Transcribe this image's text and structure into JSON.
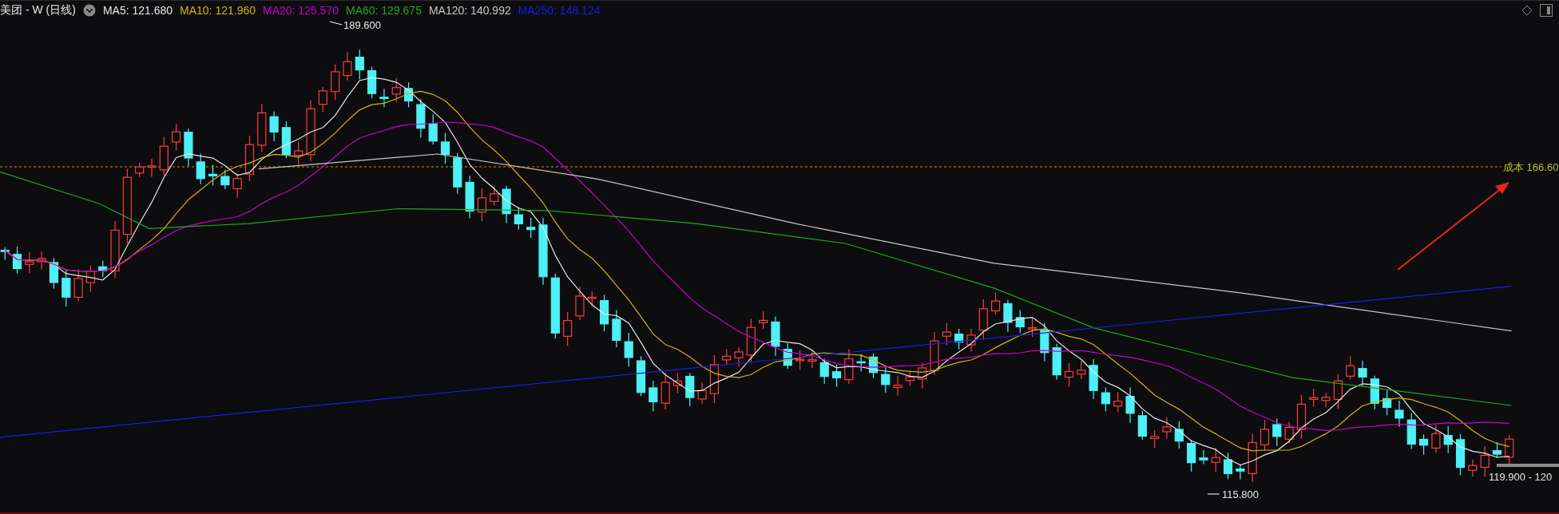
{
  "header": {
    "title": "美团 - W (日线)",
    "indicators": [
      {
        "label": "MA5: 121.680",
        "color": "#e6e6e6"
      },
      {
        "label": "MA10: 121.960",
        "color": "#d6b400"
      },
      {
        "label": "MA20: 125.570",
        "color": "#c800c8"
      },
      {
        "label": "MA60: 129.675",
        "color": "#1fa81f"
      },
      {
        "label": "MA120: 140.992",
        "color": "#c8c8c8"
      },
      {
        "label": "MA250: 148.124",
        "color": "#1c1ce6"
      }
    ]
  },
  "chart": {
    "high_label": "189.600",
    "low_label": "115.800",
    "cost_label": "成本 166.60",
    "current_range_label": "119.900 - 120"
  }
}
